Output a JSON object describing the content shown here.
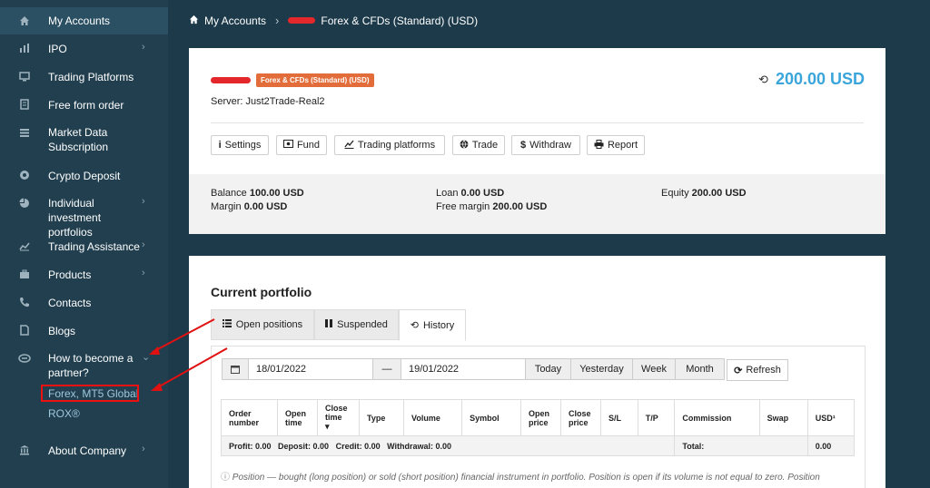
{
  "sidebar": {
    "items": [
      {
        "label": "My Accounts",
        "icon": "home-icon",
        "chevron": ""
      },
      {
        "label": "IPO",
        "icon": "bar-chart-icon",
        "chevron": "›"
      },
      {
        "label": "Trading Platforms",
        "icon": "monitor-icon",
        "chevron": ""
      },
      {
        "label": "Free form order",
        "icon": "document-icon",
        "chevron": ""
      },
      {
        "label": "Market Data Subscription",
        "icon": "list-icon",
        "chevron": ""
      },
      {
        "label": "Crypto Deposit",
        "icon": "coin-icon",
        "chevron": ""
      },
      {
        "label": "Individual investment portfolios",
        "icon": "pie-chart-icon",
        "chevron": "›"
      },
      {
        "label": "Trading Assistance",
        "icon": "line-chart-icon",
        "chevron": "›"
      },
      {
        "label": "Products",
        "icon": "briefcase-icon",
        "chevron": "›"
      },
      {
        "label": "Contacts",
        "icon": "phone-icon",
        "chevron": ""
      },
      {
        "label": "Blogs",
        "icon": "file-icon",
        "chevron": ""
      },
      {
        "label": "How to become a partner?",
        "icon": "handshake-icon",
        "chevron": "⌄"
      },
      {
        "label": "About Company",
        "icon": "bank-icon",
        "chevron": "›"
      }
    ],
    "subitems": [
      "Forex, MT5 Global",
      "ROX®"
    ]
  },
  "breadcrumb": {
    "home_label": "My Accounts",
    "separator": "›",
    "current": "Forex & CFDs (Standard) (USD)"
  },
  "account": {
    "tag": "Forex & CFDs (Standard) (USD)",
    "server": "Server: Just2Trade-Real2",
    "balance": "200.00 USD",
    "buttons": [
      "Settings",
      "Fund",
      "Trading platforms",
      "Trade",
      "Withdraw",
      "Report"
    ],
    "stats": {
      "balance_label": "Balance",
      "balance_value": "100.00 USD",
      "margin_label": "Margin",
      "margin_value": "0.00 USD",
      "loan_label": "Loan",
      "loan_value": "0.00 USD",
      "free_margin_label": "Free margin",
      "free_margin_value": "200.00 USD",
      "equity_label": "Equity",
      "equity_value": "200.00 USD"
    }
  },
  "portfolio": {
    "title": "Current portfolio",
    "tabs": [
      "Open positions",
      "Suspended",
      "History"
    ],
    "active_tab": "History",
    "date_from": "18/01/2022",
    "date_sep": "—",
    "date_to": "19/01/2022",
    "ranges": [
      "Today",
      "Yesterday",
      "Week",
      "Month"
    ],
    "refresh_label": "Refresh",
    "columns": [
      "Order number",
      "Open time",
      "Close time",
      "Type",
      "Volume",
      "Symbol",
      "Open price",
      "Close price",
      "S/L",
      "T/P",
      "Commission",
      "Swap",
      "USD¹"
    ],
    "summary": {
      "profit": "Profit: 0.00",
      "deposit": "Deposit: 0.00",
      "credit": "Credit: 0.00",
      "withdrawal": "Withdrawal: 0.00",
      "total_label": "Total:",
      "total_value": "0.00"
    },
    "note": "Position — bought (long position) or sold (short position) financial instrument in portfolio. Position is open if its volume is not equal to zero. Position"
  },
  "colors": {
    "sidebar_bg": "#213f4f",
    "page_bg": "#1c3a4a",
    "accent_blue": "#3aa5da",
    "tag_orange": "#e36d3a",
    "annotation_red": "#e11111"
  }
}
